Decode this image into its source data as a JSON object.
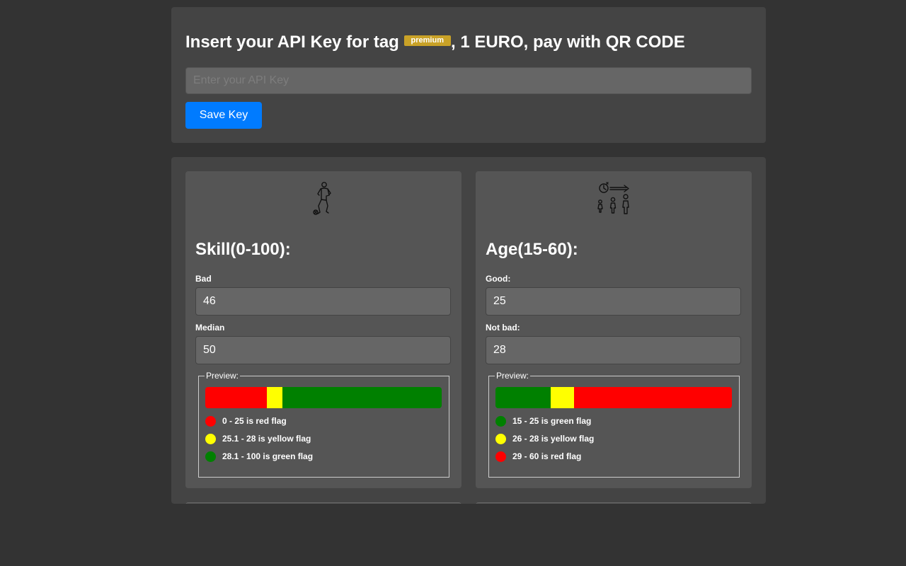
{
  "api": {
    "title_before": "Insert your API Key for tag ",
    "badge": "premium",
    "title_after": ", 1 EURO, pay with QR CODE",
    "input_placeholder": "Enter your API Key",
    "input_value": "",
    "save_label": "Save Key"
  },
  "cards": [
    {
      "icon": "footballer-icon",
      "title": "Skill(0-100):",
      "field1_label": "Bad",
      "field1_value": "46",
      "field2_label": "Median",
      "field2_value": "50",
      "preview_label": "Preview:",
      "bar": [
        {
          "color": "#ff0000",
          "fraction": 0.26
        },
        {
          "color": "#ffff00",
          "fraction": 0.065
        },
        {
          "color": "#008000",
          "fraction": 0.675
        }
      ],
      "legend": [
        {
          "color": "#ff0000",
          "text": "0 - 25 is red flag"
        },
        {
          "color": "#ffff00",
          "text": "25.1 - 28 is yellow flag"
        },
        {
          "color": "#008000",
          "text": "28.1 - 100 is green flag"
        }
      ]
    },
    {
      "icon": "age-progression-icon",
      "title": "Age(15-60):",
      "field1_label": "Good:",
      "field1_value": "25",
      "field2_label": "Not bad:",
      "field2_value": "28",
      "preview_label": "Preview:",
      "bar": [
        {
          "color": "#008000",
          "fraction": 0.233
        },
        {
          "color": "#ffff00",
          "fraction": 0.1
        },
        {
          "color": "#ff0000",
          "fraction": 0.667
        }
      ],
      "legend": [
        {
          "color": "#008000",
          "text": "15 - 25 is green flag"
        },
        {
          "color": "#ffff00",
          "text": "26 - 28 is yellow flag"
        },
        {
          "color": "#ff0000",
          "text": "29 - 60 is red flag"
        }
      ]
    }
  ],
  "colors": {
    "background": "#333333",
    "panel": "#444444",
    "card": "#555555",
    "input": "#666666",
    "primary_button": "#007bff",
    "badge": "#c9a227"
  }
}
